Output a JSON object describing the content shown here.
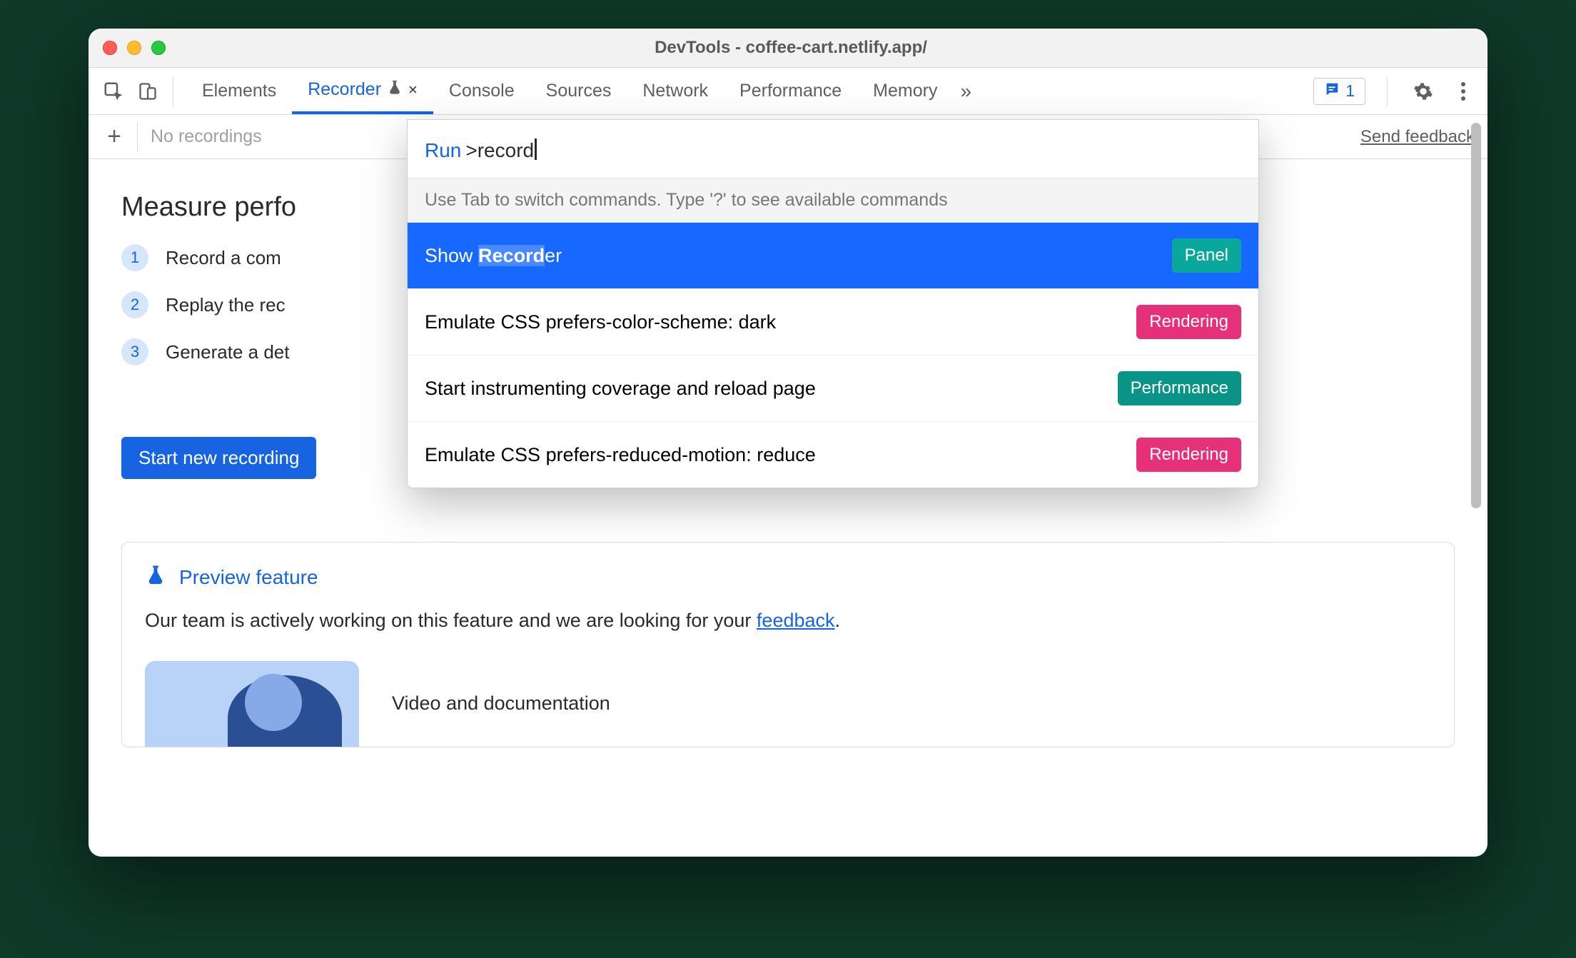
{
  "window": {
    "title": "DevTools - coffee-cart.netlify.app/"
  },
  "toolbar": {
    "tabs": {
      "elements": "Elements",
      "recorder": "Recorder",
      "console": "Console",
      "sources": "Sources",
      "network": "Network",
      "performance": "Performance",
      "memory": "Memory"
    },
    "messages_count": "1",
    "more_glyph": "»"
  },
  "subbar": {
    "no_recordings": "No recordings",
    "send_feedback": "Send feedback",
    "add_glyph": "+"
  },
  "content": {
    "heading": "Measure perfo",
    "steps": {
      "s1": {
        "num": "1",
        "text": "Record a com"
      },
      "s2": {
        "num": "2",
        "text": "Replay the rec"
      },
      "s3": {
        "num": "3",
        "text": "Generate a det"
      }
    },
    "start_button": "Start new recording",
    "card": {
      "title": "Preview feature",
      "body_prefix": "Our team is actively working on this feature and we are looking for your ",
      "body_link": "feedback",
      "body_suffix": ".",
      "media_title": "Video and documentation"
    }
  },
  "palette": {
    "run_label": "Run",
    "query_prefix": ">",
    "query_text": "record",
    "hint": "Use Tab to switch commands. Type '?' to see available commands",
    "items": [
      {
        "label": "Show Recorder",
        "badge": "Panel",
        "badge_kind": "panel",
        "selected": true
      },
      {
        "label": "Emulate CSS prefers-color-scheme: dark",
        "badge": "Rendering",
        "badge_kind": "rendering",
        "selected": false
      },
      {
        "label": "Start instrumenting coverage and reload page",
        "badge": "Performance",
        "badge_kind": "performance",
        "selected": false
      },
      {
        "label": "Emulate CSS prefers-reduced-motion: reduce",
        "badge": "Rendering",
        "badge_kind": "rendering",
        "selected": false
      }
    ]
  }
}
